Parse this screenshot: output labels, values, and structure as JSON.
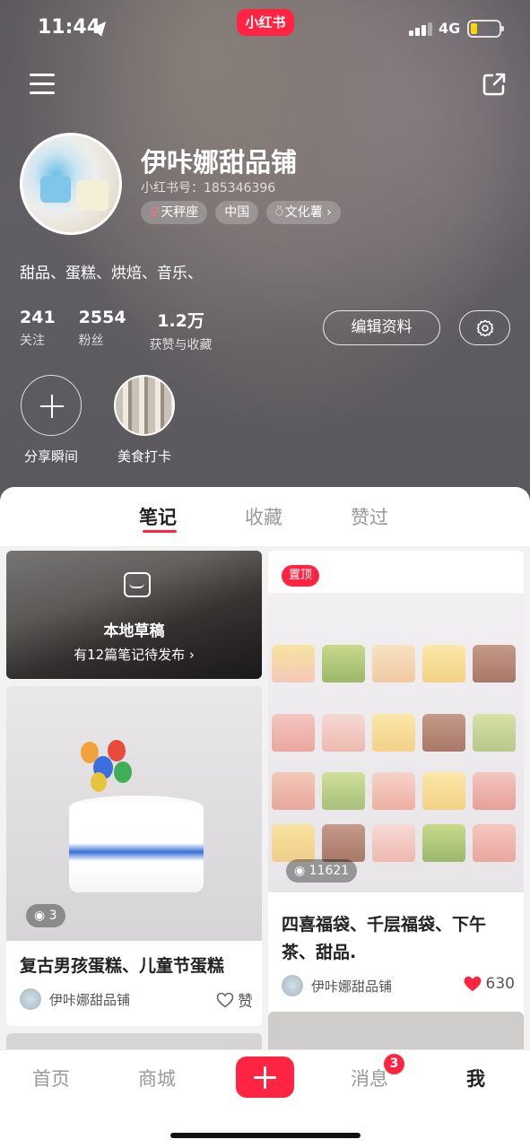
{
  "status_bar": {
    "time": "11:44",
    "network": "4G",
    "brand": "小红书"
  },
  "profile": {
    "name": "伊咔娜甜品铺",
    "red_id": "小红书号：185346396",
    "tags": [
      {
        "icon": "female-icon",
        "label": "天秤座"
      },
      {
        "icon": "",
        "label": "中国"
      },
      {
        "icon": "medal-icon",
        "label": "文化薯 ›"
      }
    ],
    "bio": "甜品、蛋糕、烘焙、音乐、",
    "stats": [
      {
        "value": "241",
        "label": "关注"
      },
      {
        "value": "2554",
        "label": "粉丝"
      },
      {
        "value": "1.2万",
        "label": "获赞与收藏"
      }
    ],
    "edit_label": "编辑资料",
    "highlights": [
      {
        "label": "分享瞬间"
      },
      {
        "label": "美食打卡"
      }
    ]
  },
  "tabs": [
    {
      "label": "笔记",
      "active": true
    },
    {
      "label": "收藏",
      "active": false
    },
    {
      "label": "赞过",
      "active": false
    }
  ],
  "feed": {
    "draft": {
      "title": "本地草稿",
      "subtitle": "有12篇笔记待发布 ›"
    },
    "notes": [
      {
        "title": "复古男孩蛋糕、儿童节蛋糕",
        "views": "3",
        "author": "伊咔娜甜品铺",
        "like_label": "赞",
        "pinned": false
      },
      {
        "title": "四喜福袋、千层福袋、下午茶、甜品.",
        "views": "11621",
        "author": "伊咔娜甜品铺",
        "likes": "630",
        "pinned": true,
        "pin_label": "置顶"
      }
    ]
  },
  "bottom_nav": {
    "items": [
      "首页",
      "商城",
      "消息",
      "我"
    ],
    "active": "我",
    "messages_badge": "3"
  },
  "colors": {
    "accent": "#ff2442",
    "battery": "#ffd60a"
  }
}
